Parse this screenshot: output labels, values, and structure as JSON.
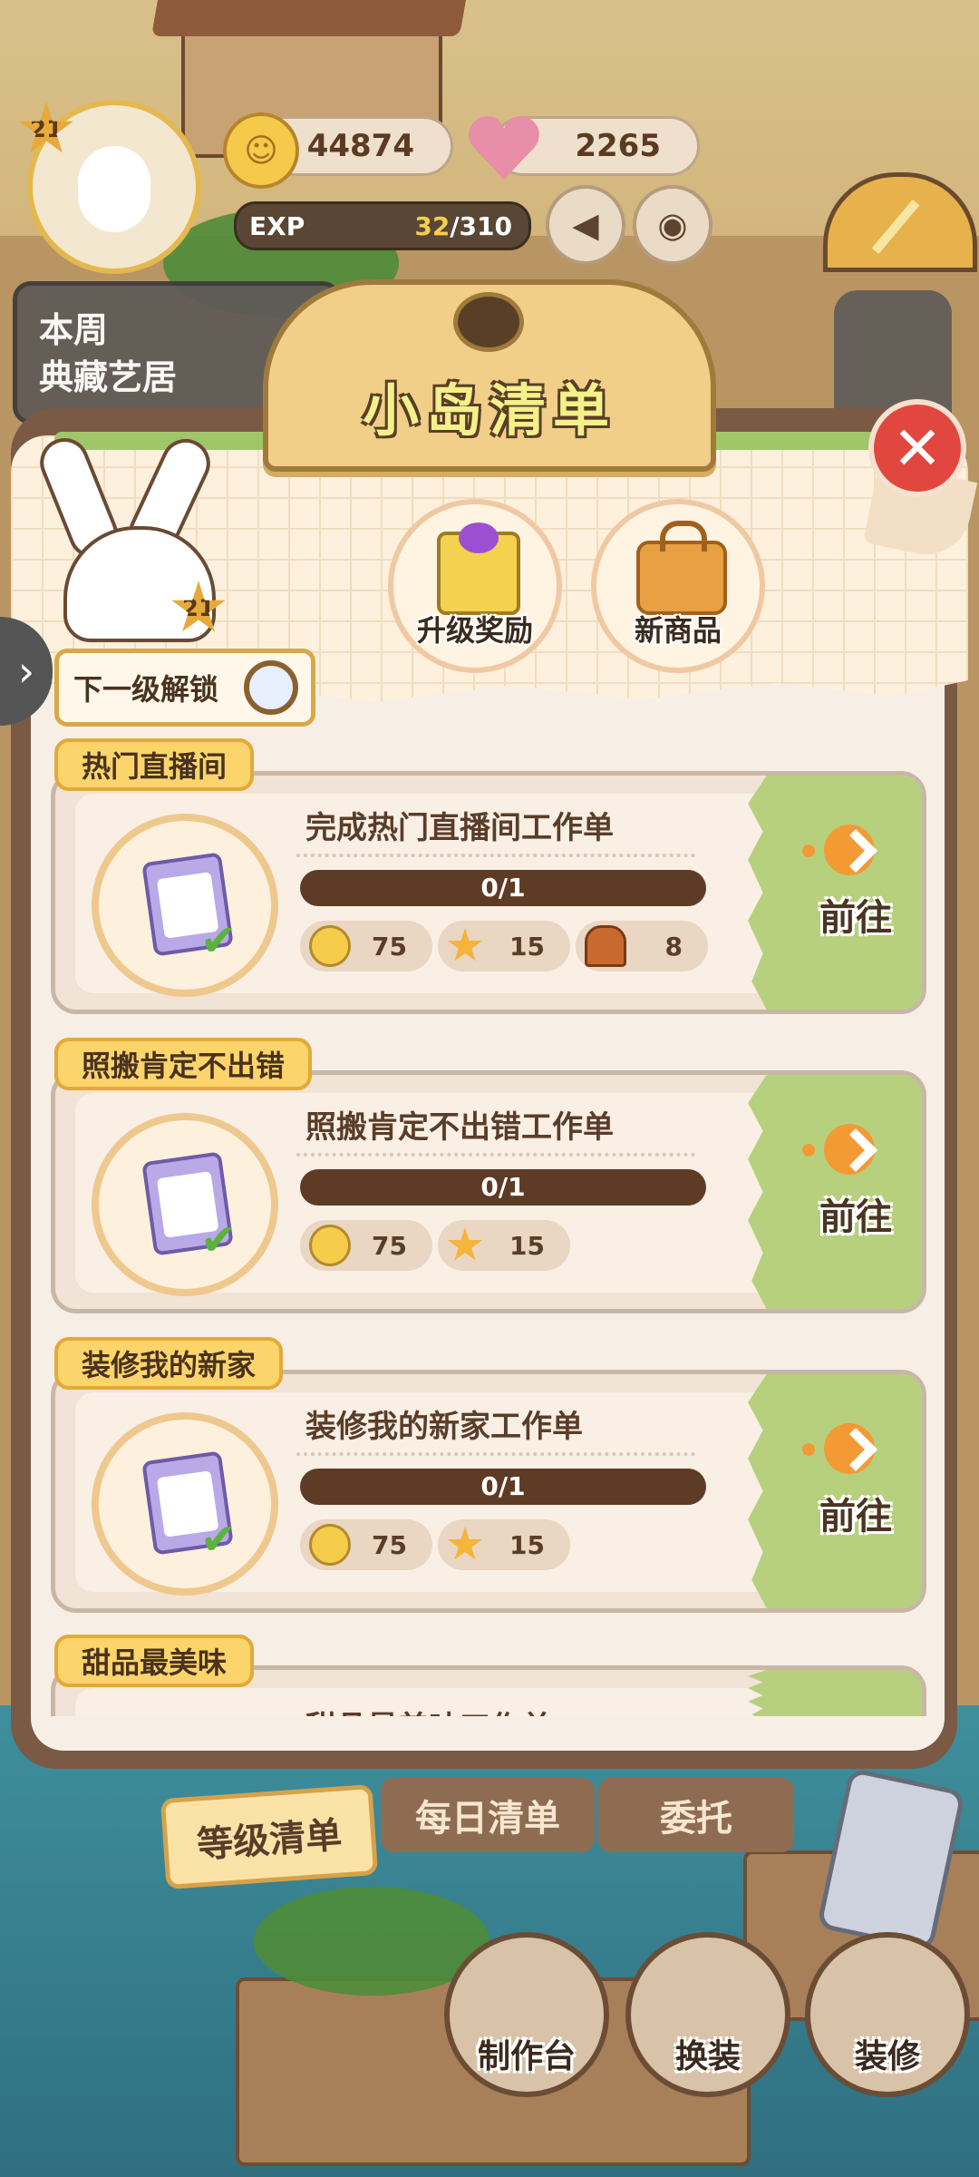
{
  "hud": {
    "level": "21",
    "coins": "44874",
    "hearts": "2265",
    "exp_label": "EXP",
    "exp_current": "32",
    "exp_total": "/310",
    "weekly_line1": "本周",
    "weekly_line2": "典藏艺居"
  },
  "modal": {
    "title": "小岛清单",
    "mascot_level": "21",
    "unlock_label": "下一级解锁",
    "rewards": [
      {
        "label": "升级奖励",
        "icon": "gift-icon"
      },
      {
        "label": "新商品",
        "icon": "bag-icon"
      }
    ],
    "tasks": [
      {
        "tag": "热门直播间",
        "title": "完成热门直播间工作单",
        "progress": "0/1",
        "go": "前往",
        "rewards": [
          {
            "icon": "coin",
            "value": "75"
          },
          {
            "icon": "star",
            "value": "15"
          },
          {
            "icon": "ore",
            "value": "8"
          }
        ]
      },
      {
        "tag": "照搬肯定不出错",
        "title": "照搬肯定不出错工作单",
        "progress": "0/1",
        "go": "前往",
        "rewards": [
          {
            "icon": "coin",
            "value": "75"
          },
          {
            "icon": "star",
            "value": "15"
          }
        ]
      },
      {
        "tag": "装修我的新家",
        "title": "装修我的新家工作单",
        "progress": "0/1",
        "go": "前往",
        "rewards": [
          {
            "icon": "coin",
            "value": "75"
          },
          {
            "icon": "star",
            "value": "15"
          }
        ]
      },
      {
        "tag": "甜品最美味",
        "title": "甜品最美味工作单"
      }
    ]
  },
  "tabs": [
    "等级清单",
    "每日清单",
    "委托"
  ],
  "dock": [
    "制作台",
    "换装",
    "装修"
  ],
  "colors": {
    "accent_green": "#b6d07e",
    "progress_bar": "#5e3b25",
    "close_red": "#e2473f",
    "tag_yellow": "#fbd56c"
  }
}
